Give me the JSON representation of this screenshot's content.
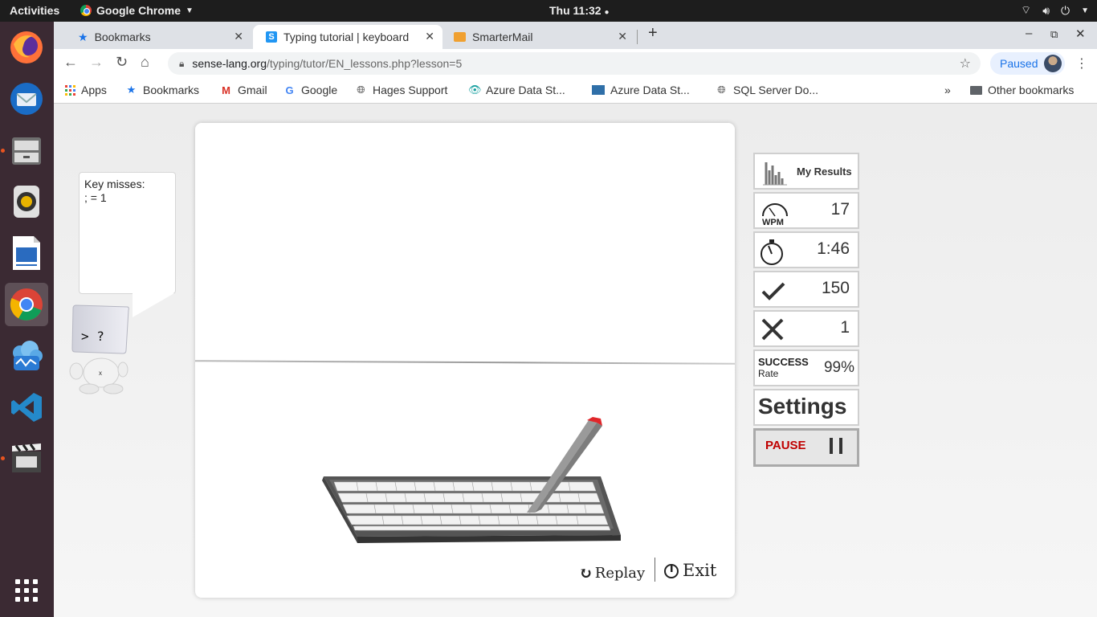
{
  "topbar": {
    "activities": "Activities",
    "app_name": "Google Chrome",
    "clock": "Thu 11:32"
  },
  "dock": {
    "items": [
      "firefox-icon",
      "thunderbird-icon",
      "files-icon",
      "rhythmbox-icon",
      "writer-icon",
      "chrome-icon",
      "azure-data-studio-icon",
      "vscode-icon",
      "video-editor-icon",
      "show-apps-icon"
    ]
  },
  "tabs": [
    {
      "title": "Bookmarks",
      "icon": "star-icon"
    },
    {
      "title": "Typing tutorial | keyboard",
      "icon": "sense-lang-icon"
    },
    {
      "title": "SmarterMail",
      "icon": "mail-icon"
    }
  ],
  "omnibox": {
    "host": "sense-lang.org",
    "path": "/typing/tutor/EN_lessons.php?lesson=5"
  },
  "profile": {
    "label": "Paused"
  },
  "bookmarks": [
    {
      "label": "Apps"
    },
    {
      "label": "Bookmarks"
    },
    {
      "label": "Gmail"
    },
    {
      "label": "Google"
    },
    {
      "label": "Hages Support"
    },
    {
      "label": "Azure Data St..."
    },
    {
      "label": "Azure Data St..."
    },
    {
      "label": "SQL Server Do..."
    }
  ],
  "bookmarks_overflow": "»",
  "other_bookmarks": "Other bookmarks",
  "feedback": {
    "title": "Key misses:",
    "line": "; = 1"
  },
  "robot_face": "> ?",
  "panel": {
    "replay": "Replay",
    "exit": "Exit"
  },
  "stats": {
    "results_label": "My Results",
    "wpm_label": "WPM",
    "wpm": "17",
    "time": "1:46",
    "correct": "150",
    "errors": "1",
    "success_label_1": "SUCCESS",
    "success_label_2": "Rate",
    "success": "99%",
    "settings": "Settings",
    "pause": "PAUSE"
  },
  "colors": {
    "topbar": "#1d1d1d",
    "dock": "#3b2a33",
    "pause_text": "#c00000",
    "key_marker": "#e0262a"
  }
}
